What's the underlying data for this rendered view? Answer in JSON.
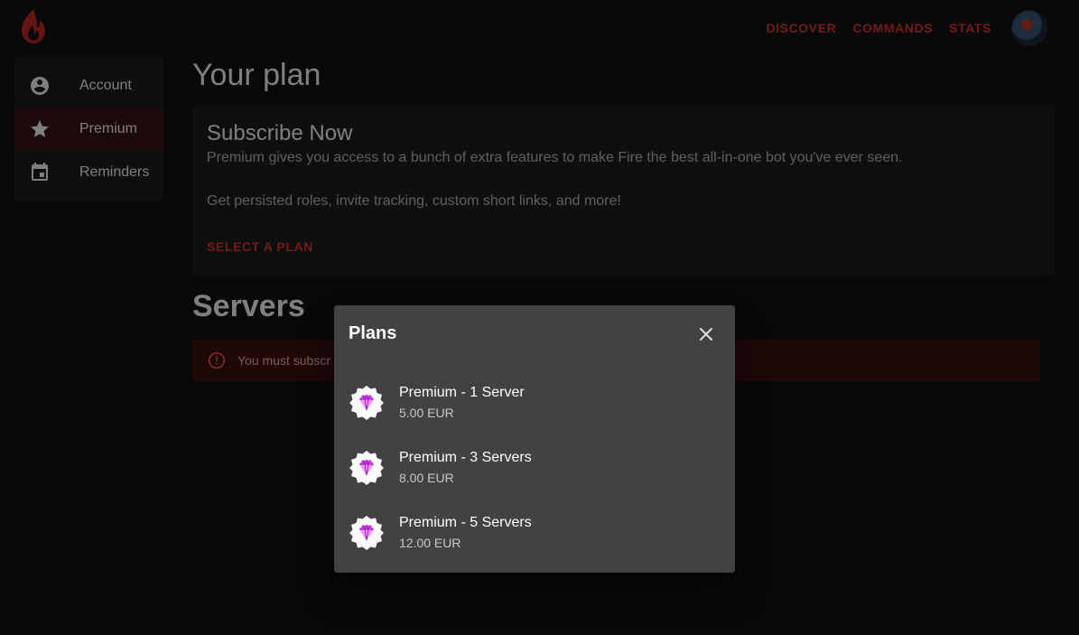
{
  "nav": {
    "links": [
      "DISCOVER",
      "COMMANDS",
      "STATS"
    ]
  },
  "sidebar": {
    "items": [
      {
        "label": "Account",
        "icon": "account-circle-icon"
      },
      {
        "label": "Premium",
        "icon": "star-icon",
        "active": true
      },
      {
        "label": "Reminders",
        "icon": "calendar-icon"
      }
    ]
  },
  "main": {
    "title": "Your plan",
    "card": {
      "title": "Subscribe Now",
      "text1": "Premium gives you access to a bunch of extra features to make Fire the best all-in-one bot you've ever seen.",
      "text2": "Get persisted roles, invite tracking, custom short links, and more!",
      "action": "SELECT A PLAN"
    },
    "servers_title": "Servers",
    "alert_text": "You must subscr"
  },
  "dialog": {
    "title": "Plans",
    "plans": [
      {
        "name": "Premium - 1 Server",
        "price": "5.00 EUR"
      },
      {
        "name": "Premium - 3 Servers",
        "price": "8.00 EUR"
      },
      {
        "name": "Premium - 5 Servers",
        "price": "12.00 EUR"
      }
    ]
  },
  "colors": {
    "accent": "#e53935",
    "background": "#121212",
    "surface": "#1e1e1e",
    "dialog": "#424242",
    "gem": "#e040fb"
  }
}
